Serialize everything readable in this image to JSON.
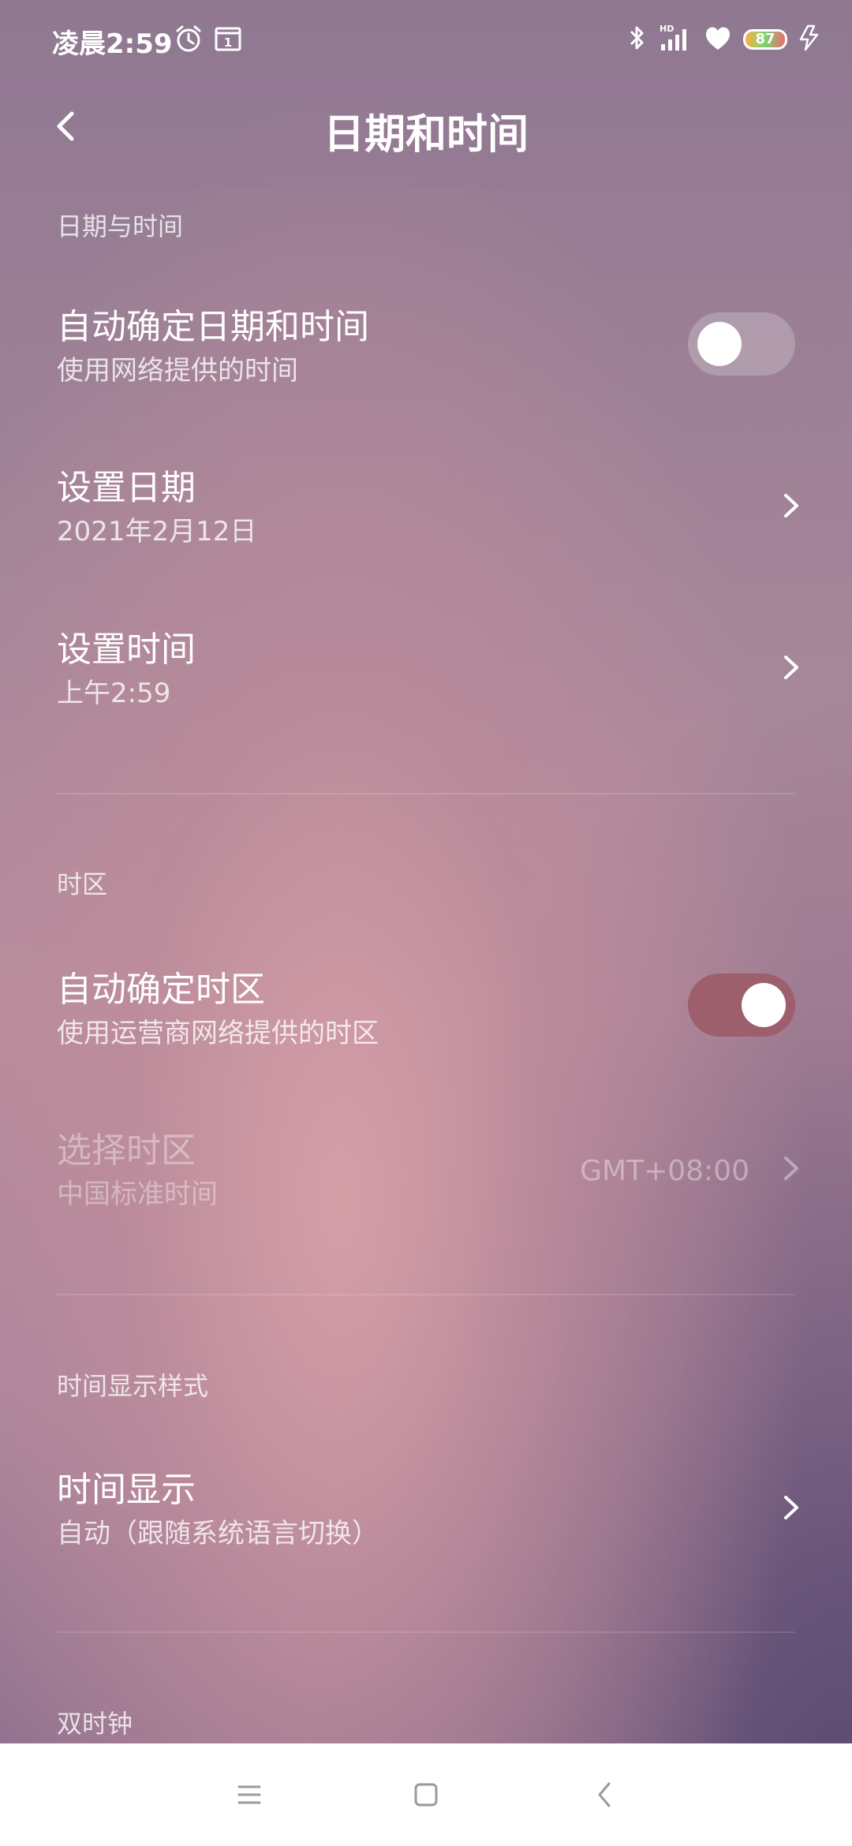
{
  "status_bar": {
    "time": "凌晨2:59",
    "calendar_day": "1",
    "battery_level": "87",
    "icons": [
      "alarm-icon",
      "calendar-icon",
      "bluetooth-icon",
      "hd-signal-icon",
      "heart-icon",
      "battery-icon",
      "charging-icon"
    ]
  },
  "header": {
    "title": "日期和时间",
    "back_icon": "back-arrow-icon"
  },
  "sections": {
    "date_time": {
      "header": "日期与时间",
      "auto_datetime": {
        "title": "自动确定日期和时间",
        "subtitle": "使用网络提供的时间",
        "toggle_on": false
      },
      "set_date": {
        "title": "设置日期",
        "subtitle": "2021年2月12日"
      },
      "set_time": {
        "title": "设置时间",
        "subtitle": "上午2:59"
      }
    },
    "timezone": {
      "header": "时区",
      "auto_timezone": {
        "title": "自动确定时区",
        "subtitle": "使用运营商网络提供的时区",
        "toggle_on": true
      },
      "select_timezone": {
        "title": "选择时区",
        "subtitle": "中国标准时间",
        "value": "GMT+08:00",
        "enabled": false
      }
    },
    "time_format": {
      "header": "时间显示样式",
      "time_display": {
        "title": "时间显示",
        "subtitle": "自动（跟随系统语言切换）"
      }
    },
    "dual_clock": {
      "header": "双时钟"
    }
  },
  "nav_bar": {
    "icons": [
      "menu-icon",
      "home-icon",
      "back-icon"
    ]
  },
  "colors": {
    "toggle_on": "#9c5f6b",
    "toggle_off": "rgba(255,255,255,0.22)",
    "nav_bg": "#ffffff",
    "nav_icon": "#9a9a9a"
  }
}
